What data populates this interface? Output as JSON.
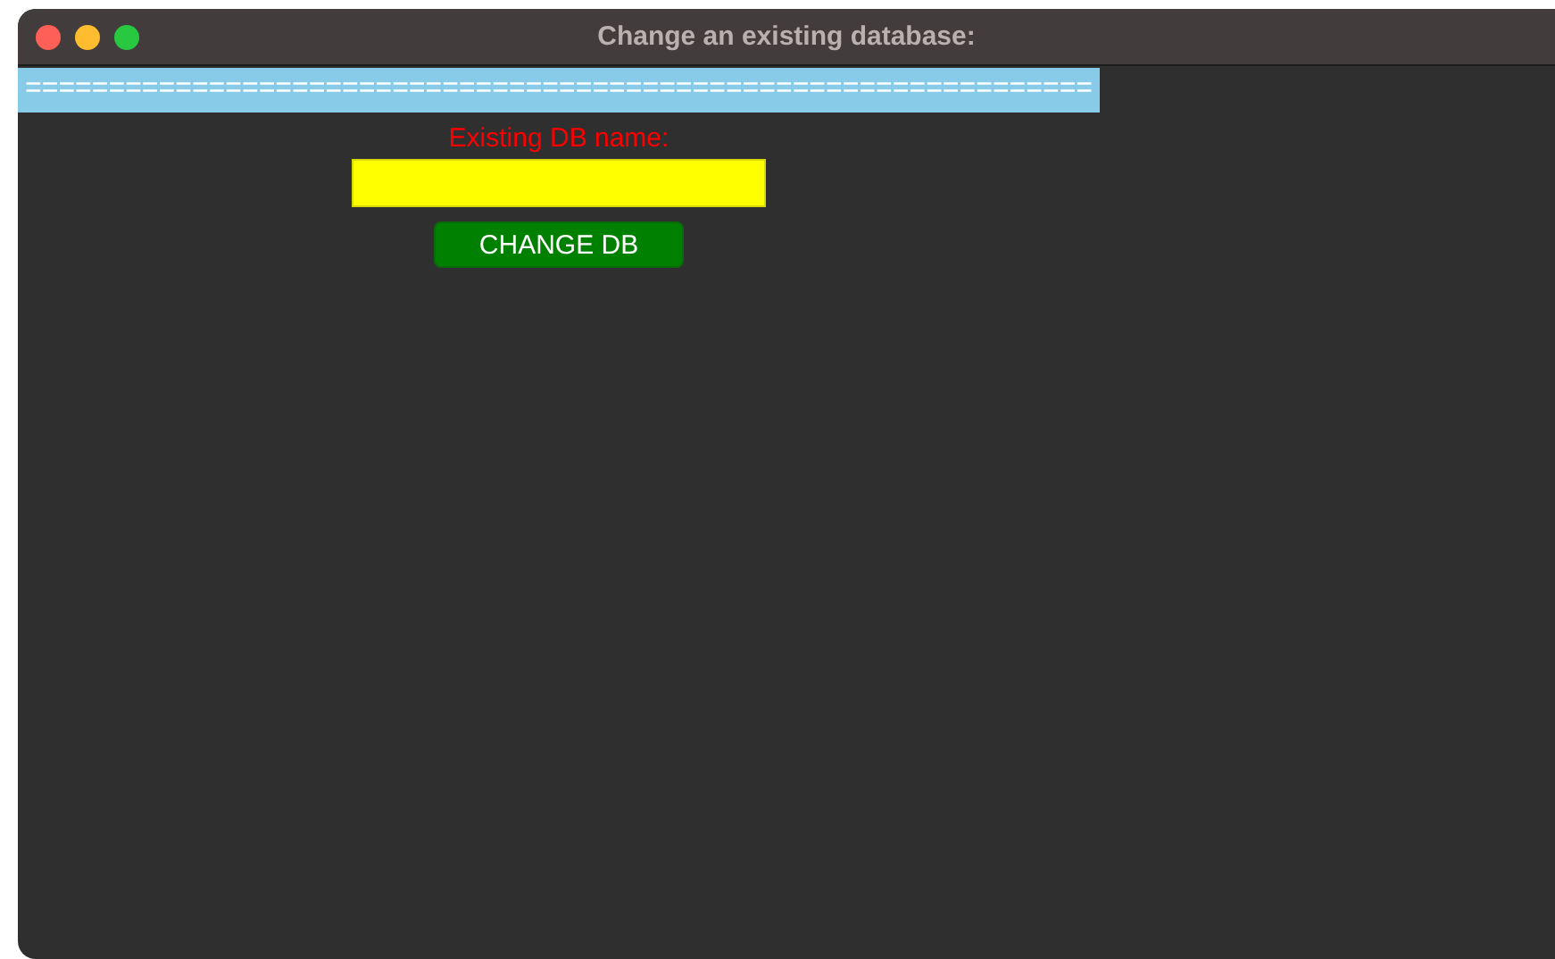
{
  "window": {
    "title": "Change an existing database:"
  },
  "banner": "================================================================",
  "form": {
    "label": "Existing DB name:",
    "button": "CHANGE DB"
  }
}
